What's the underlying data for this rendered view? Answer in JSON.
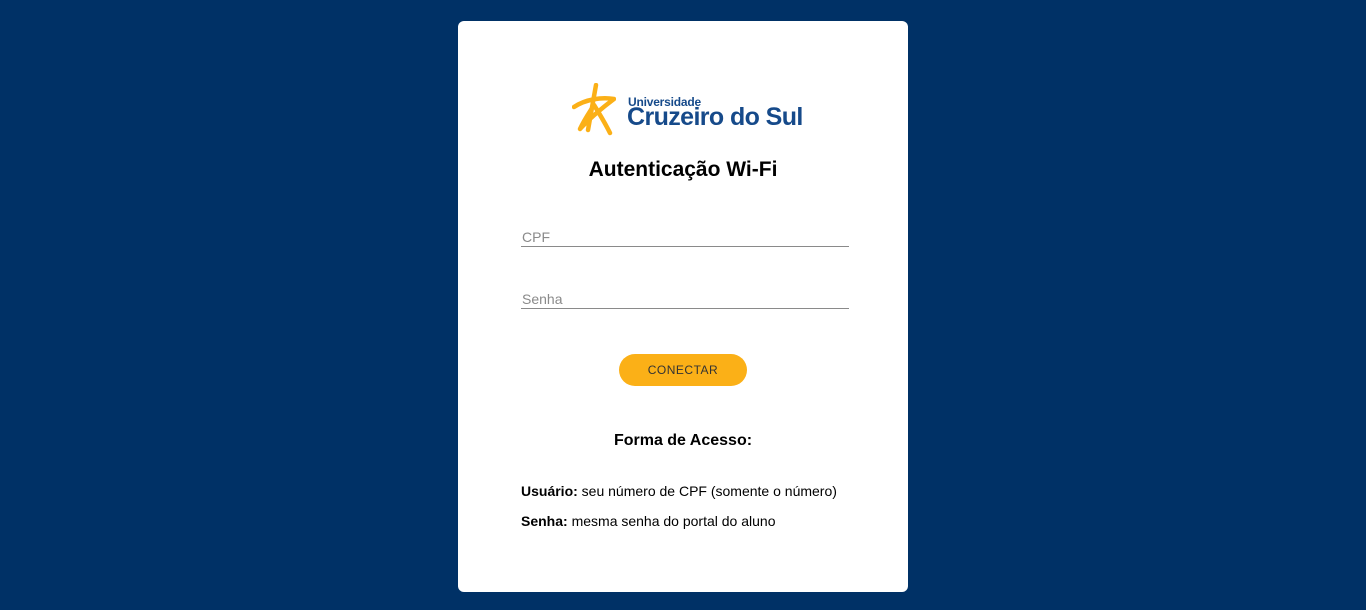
{
  "logo": {
    "small_text": "Universidade",
    "big_text": "Cruzeiro do Sul",
    "star_color": "#fbb017",
    "text_color": "#164a8a"
  },
  "title": "Autenticação Wi-Fi",
  "form": {
    "cpf_placeholder": "CPF",
    "cpf_value": "",
    "senha_placeholder": "Senha",
    "senha_value": "",
    "submit_label": "CONECTAR"
  },
  "access": {
    "heading": "Forma de Acesso:",
    "user_label": "Usuário:",
    "user_text": " seu número de CPF (somente o número)",
    "password_label": "Senha:",
    "password_text": " mesma senha do portal do aluno"
  },
  "colors": {
    "background": "#003166",
    "card": "#ffffff",
    "button": "#fbb017"
  }
}
